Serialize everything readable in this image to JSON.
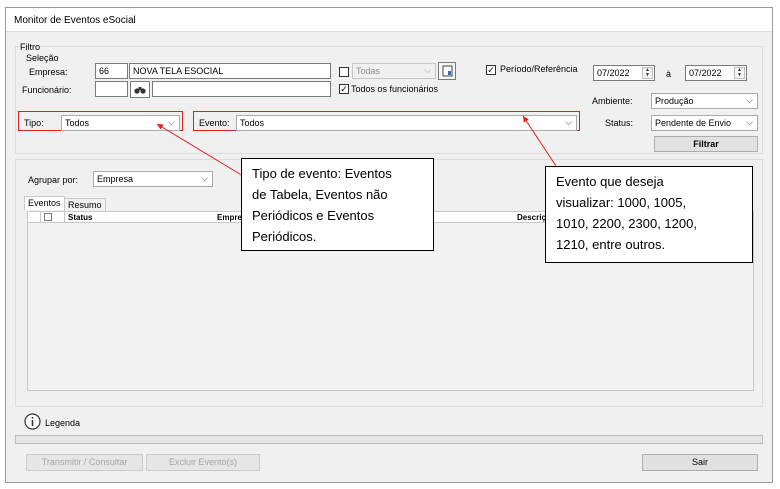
{
  "window": {
    "title": "Monitor de Eventos eSocial"
  },
  "filter": {
    "group_label": "Filtro",
    "selection_label": "Seleção",
    "empresa_label": "Empresa:",
    "empresa_code": "66",
    "empresa_name": "NOVA TELA ESOCIAL",
    "todas_checked": false,
    "todas_value": "Todas",
    "funcionario_label": "Funcionário:",
    "funcionario_code": "",
    "funcionario_name": "",
    "todos_funcionarios_label": "Todos os funcionários",
    "todos_funcionarios_checked": true,
    "periodo_label": "Período/Referência",
    "periodo_checked": true,
    "periodo_start": "07/2022",
    "periodo_sep": "à",
    "periodo_end": "07/2022",
    "ambiente_label": "Ambiente:",
    "ambiente_value": "Produção",
    "tipo_label": "Tipo:",
    "tipo_value": "Todos",
    "evento_label": "Evento:",
    "evento_value": "Todos",
    "status_label": "Status:",
    "status_value": "Pendente de Envio",
    "filtrar_label": "Filtrar"
  },
  "grouping": {
    "label": "Agrupar por:",
    "value": "Empresa"
  },
  "tabs": [
    {
      "label": "Eventos",
      "active": true
    },
    {
      "label": "Resumo",
      "active": false
    }
  ],
  "grid": {
    "columns": [
      "Status",
      "Empresa",
      "Descrição"
    ]
  },
  "legend_label": "Legenda",
  "footer": {
    "transmit_label": "Transmitir / Consultar",
    "delete_label": "Excluir Evento(s)",
    "exit_label": "Sair"
  },
  "annotations": {
    "tipo_callout": [
      "Tipo de evento: Eventos",
      "de Tabela, Eventos não",
      "Periódicos e Eventos",
      "Periódicos."
    ],
    "evento_callout": [
      "Evento que deseja",
      "visualizar: 1000, 1005,",
      "1010, 2200, 2300, 1200,",
      "1210, entre outros."
    ],
    "arrow_color": "#e02020"
  }
}
